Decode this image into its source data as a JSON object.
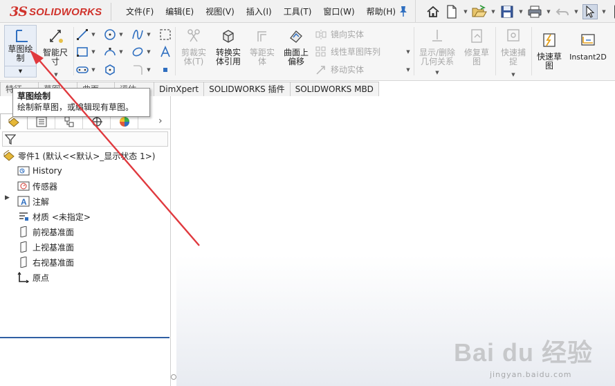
{
  "app": {
    "logo_ds": "3S",
    "logo_text": "SOLIDWORKS"
  },
  "menubar": {
    "items": [
      "文件(F)",
      "编辑(E)",
      "视图(V)",
      "插入(I)",
      "工具(T)",
      "窗口(W)",
      "帮助(H)"
    ]
  },
  "ribbon": {
    "sketch_label": "草图绘\n制",
    "smart_dim_label": "智能尺\n寸",
    "trim_label": "剪裁实\n体(T)",
    "convert_label": "转换实\n体引用",
    "offset_label": "等距实\n体",
    "surface_offset_label": "曲面上\n偏移",
    "mirror_label": "镜向实体",
    "linear_pattern_label": "线性草图阵列",
    "move_label": "移动实体",
    "show_relations_label": "显示/删除\n几何关系",
    "repair_label": "修复草\n图",
    "quick_snap_label": "快速捕\n捉",
    "rapid_sketch_label": "快速草\n图",
    "instant2d_label": "Instant2D"
  },
  "tabs": [
    "特征",
    "草图",
    "曲面",
    "评估",
    "DimXpert",
    "SOLIDWORKS 插件",
    "SOLIDWORKS MBD"
  ],
  "tooltip": {
    "title": "草图绘制",
    "body": "绘制新草图，或编辑现有草图。"
  },
  "tree": {
    "root": "零件1 (默认<<默认>_显示状态 1>)",
    "items": [
      "History",
      "传感器",
      "注解",
      "材质 <未指定>",
      "前视基准面",
      "上视基准面",
      "右视基准面",
      "原点"
    ]
  },
  "watermark": {
    "main": "Bai du 经验",
    "url": "jingyan.baidu.com"
  },
  "colors": {
    "brand_red": "#d0332c",
    "annotation_arrow": "#e0393e",
    "tree_underline": "#2f5fa3"
  }
}
